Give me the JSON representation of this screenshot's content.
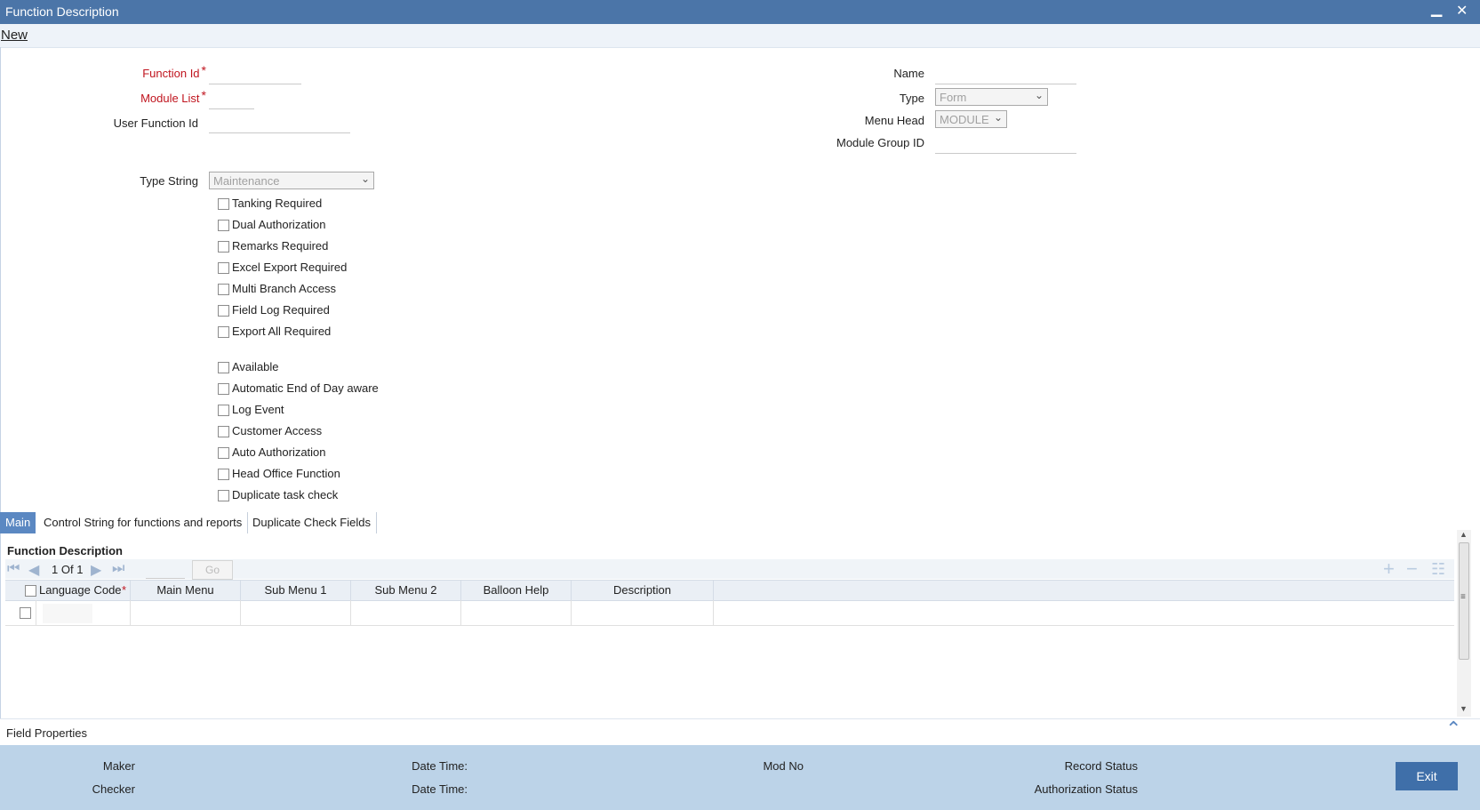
{
  "window": {
    "title": "Function Description",
    "minimize_glyph": "▁",
    "close_glyph": "✕"
  },
  "toolbar": {
    "new_label": "New"
  },
  "form": {
    "function_id_label": "Function Id",
    "module_list_label": "Module List",
    "user_function_id_label": "User Function Id",
    "name_label": "Name",
    "type_label": "Type",
    "type_value": "Form",
    "menu_head_label": "Menu Head",
    "menu_head_value": "MODULE",
    "module_group_id_label": "Module Group ID",
    "type_string_label": "Type String",
    "type_string_value": "Maintenance",
    "required_star": "*"
  },
  "checkboxes_group1": [
    {
      "label": "Tanking Required"
    },
    {
      "label": "Dual Authorization"
    },
    {
      "label": "Remarks Required"
    },
    {
      "label": "Excel Export Required"
    },
    {
      "label": "Multi Branch Access"
    },
    {
      "label": "Field Log Required"
    },
    {
      "label": "Export All Required"
    }
  ],
  "checkboxes_group2": [
    {
      "label": "Available"
    },
    {
      "label": "Automatic End of Day aware"
    },
    {
      "label": "Log Event"
    },
    {
      "label": "Customer Access"
    },
    {
      "label": "Auto Authorization"
    },
    {
      "label": "Head Office Function"
    },
    {
      "label": "Duplicate task check"
    }
  ],
  "tabs": [
    {
      "label": "Main"
    },
    {
      "label": "Control String for functions and reports"
    },
    {
      "label": "Duplicate Check Fields"
    }
  ],
  "grid": {
    "section_title": "Function Description",
    "page_current": "1",
    "page_of": "Of",
    "page_total": "1",
    "go_label": "Go",
    "columns": [
      "Language Code",
      "Main Menu",
      "Sub Menu 1",
      "Sub Menu 2",
      "Balloon Help",
      "Description"
    ]
  },
  "field_properties": {
    "label": "Field Properties"
  },
  "footer": {
    "maker_label": "Maker",
    "checker_label": "Checker",
    "date_time_label_1": "Date Time:",
    "date_time_label_2": "Date Time:",
    "mod_no_label": "Mod No",
    "record_status_label": "Record Status",
    "authorization_status_label": "Authorization Status",
    "exit_label": "Exit"
  },
  "icons": {
    "first": "⏮",
    "prev": "◀",
    "next": "▶",
    "last": "⏭",
    "add": "+",
    "delete": "−",
    "list": "☷",
    "chevron": "⌄",
    "collapse": "⌃",
    "up_arrow": "▲",
    "down_arrow": "▼",
    "grip": "≡"
  },
  "colors": {
    "titlebar": "#4b75a8",
    "footer": "#bcd3e8",
    "required": "#c0141e",
    "active_tab": "#5b88c2"
  }
}
